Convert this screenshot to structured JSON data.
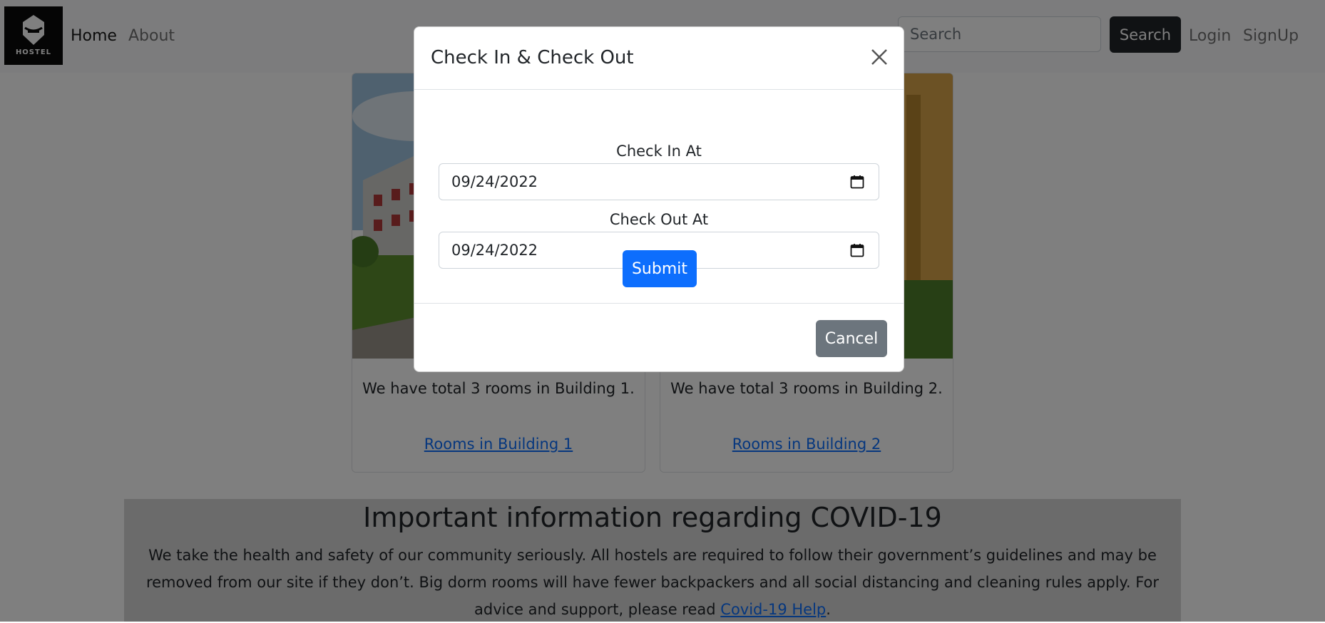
{
  "navbar": {
    "brand_text": "HOSTEL",
    "links": {
      "home": "Home",
      "about": "About",
      "login": "Login",
      "signup": "SignUp"
    },
    "search": {
      "placeholder": "Search",
      "button_label": "Search"
    }
  },
  "cards": [
    {
      "text": "We have total 3 rooms in Building 1.",
      "link": "Rooms in Building 1"
    },
    {
      "text": "We have total 3 rooms in Building 2.",
      "link": "Rooms in Building 2"
    }
  ],
  "covid": {
    "title": "Important information regarding COVID-19",
    "body": "We take the health and safety of our community seriously. All hostels are required to follow their government’s guidelines and may be removed from our site if they don’t. Big dorm rooms will have fewer backpackers and all social distancing and cleaning rules apply. For advice and support, please read",
    "link": "Covid-19 Help",
    "suffix": "."
  },
  "modal": {
    "title": "Check In & Check Out",
    "check_in": {
      "label": "Check In At",
      "value": "09/24/2022"
    },
    "check_out": {
      "label": "Check Out At",
      "value": "09/24/2022"
    },
    "submit_label": "Submit",
    "cancel_label": "Cancel"
  },
  "colors": {
    "primary": "#0d6efd",
    "secondary": "#6c757d",
    "dark": "#212529",
    "covid_bg": "#d6d6d6"
  }
}
